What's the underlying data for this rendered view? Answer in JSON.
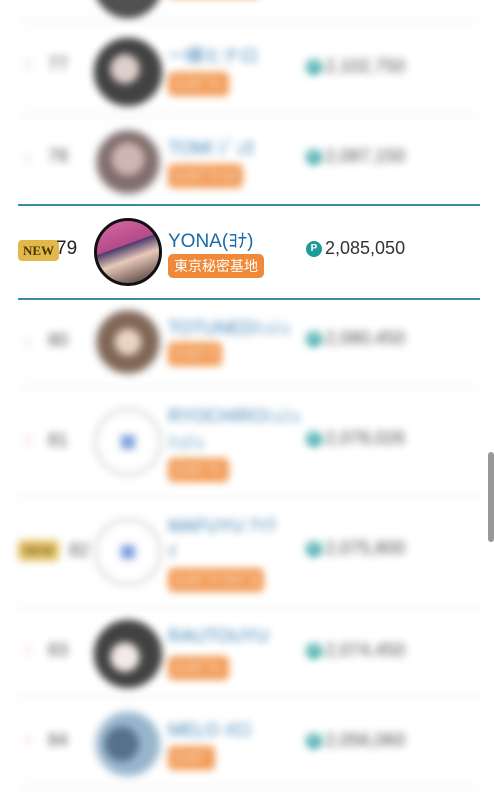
{
  "rows": [
    {
      "rank": "77",
      "arrow": "↑",
      "name": "一縁ヒナロ",
      "tag": "ﾗﾝｸﾊﾟﾜｰ",
      "points": "2,102,750"
    },
    {
      "rank": "78",
      "arrow": "↓",
      "name": "TOMI ｼﾞｭｶ",
      "tag": "ﾗﾝｸﾊﾟﾜｰﾊｲ",
      "points": "2,087,150"
    },
    {
      "rank": "80",
      "arrow": "↓",
      "name": "TOTUNEDｼｭｼｭ",
      "tag": "ﾗﾝｸﾊﾟﾜ",
      "points": "2,080,450"
    },
    {
      "rank": "81",
      "arrow": "↑",
      "name": "RYOCHIROｼｭｼｭ",
      "name2": "ｼｭｼｭ",
      "tag": "ﾗﾝｸﾊﾟﾜｰ",
      "points": "2,078,026"
    },
    {
      "rank": "82",
      "arrow": "",
      "badge": "NEW",
      "name": "MAFUYU ｱｲｸ",
      "name2": "ｲ",
      "tag": "ﾗﾝｸﾊﾟﾜｰｱｲﾄﾞﾙ",
      "points": "2,075,800"
    },
    {
      "rank": "83",
      "arrow": "↑",
      "name": "RAUTOUYU",
      "tag": "ﾗﾝｸﾊﾟﾜｰ",
      "points": "2,074,450"
    },
    {
      "rank": "84",
      "arrow": "↑",
      "name": "MELO ﾒﾛｺ",
      "tag": "ﾗﾝｸﾊﾟ",
      "points": "2,056,060"
    }
  ],
  "current": {
    "badge": "NEW",
    "rank": "79",
    "name": "YONA(ﾖﾅ)",
    "tag": "東京秘密基地",
    "points_icon": "P",
    "points": "2,085,050"
  },
  "colors": {
    "accent": "#1a6aa6",
    "tag": "#f08a3a",
    "coin": "#1f9a9a",
    "new_badge": "#e2b84a",
    "highlight_line": "#3a8aa0"
  }
}
